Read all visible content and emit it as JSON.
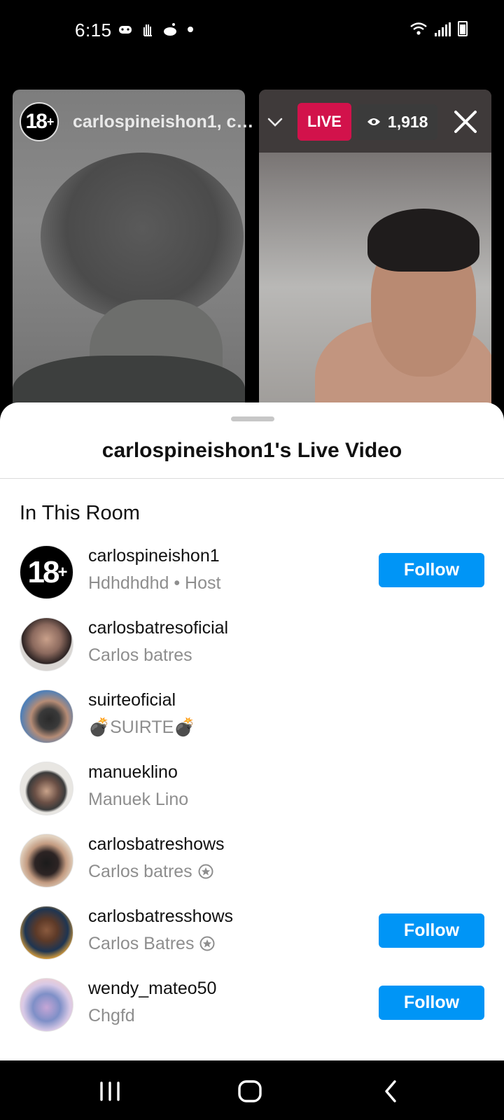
{
  "status_bar": {
    "time": "6:15",
    "icons_left": [
      "gamepad-icon",
      "hand-icon",
      "reddit-icon",
      "dot"
    ],
    "icons_right": [
      "wifi-icon",
      "signal-icon",
      "battery-icon"
    ]
  },
  "live": {
    "host_avatar_text": "18+",
    "title": "carlospineishon1, ca...",
    "live_label": "LIVE",
    "viewer_count": "1,918",
    "accent_color": "#d2124b"
  },
  "sheet": {
    "title": "carlospineishon1's Live Video",
    "section_title": "In This Room",
    "follow_label": "Follow",
    "participants": [
      {
        "username": "carlospineishon1",
        "subtitle": "Hdhdhdhd • Host",
        "avatar": "18+",
        "show_follow": true,
        "verified": false
      },
      {
        "username": "carlosbatresoficial",
        "subtitle": "Carlos batres",
        "avatar": "photo",
        "show_follow": false,
        "verified": false
      },
      {
        "username": "suirteoficial",
        "subtitle": "💣SUIRTE💣",
        "avatar": "photo",
        "show_follow": false,
        "verified": false
      },
      {
        "username": "manueklino",
        "subtitle": "Manuek Lino",
        "avatar": "photo",
        "show_follow": false,
        "verified": false
      },
      {
        "username": "carlosbatreshows",
        "subtitle": "Carlos batres",
        "avatar": "photo",
        "show_follow": false,
        "verified": true
      },
      {
        "username": "carlosbatresshows",
        "subtitle": "Carlos Batres",
        "avatar": "photo",
        "show_follow": true,
        "verified": true
      },
      {
        "username": "wendy_mateo50",
        "subtitle": "Chgfd",
        "avatar": "photo",
        "show_follow": true,
        "verified": false
      }
    ],
    "follow_color": "#0095f6"
  },
  "nav_bar": {
    "items": [
      "recents-icon",
      "home-icon",
      "back-icon"
    ]
  }
}
